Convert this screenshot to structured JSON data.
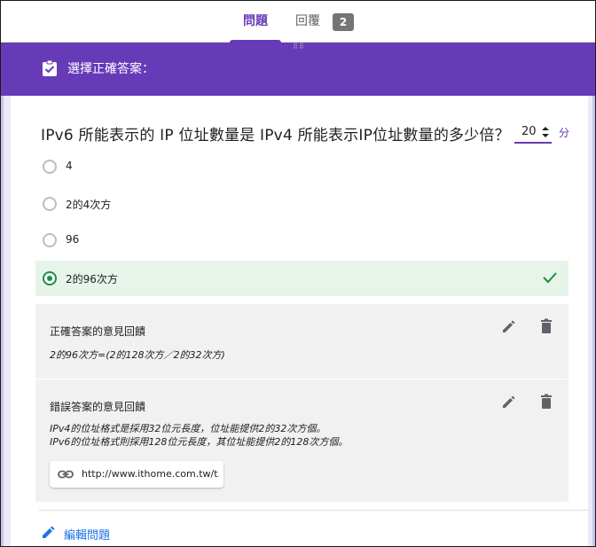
{
  "tabs": [
    {
      "label": "問題"
    },
    {
      "label": "回覆",
      "count": "2"
    }
  ],
  "header": {
    "label": "選擇正確答案："
  },
  "question": {
    "title": "IPv6 所能表示的 IP 位址數量是 IPv4 所能表示IP位址數量的多少倍？",
    "points_value": "20",
    "points_unit": "分"
  },
  "options": [
    {
      "label": "4"
    },
    {
      "label": "2的4次方"
    },
    {
      "label": "96"
    },
    {
      "label": "2的96次方"
    }
  ],
  "feedback_correct": {
    "title": "正確答案的意見回饋",
    "text": "2的96次方=(2的128次方／2的32次方)"
  },
  "feedback_wrong": {
    "title": "錯誤答案的意見回饋",
    "line1": "IPv4的位址格式是採用32位元長度，位址能提供2的32次方個。",
    "line2": "IPv6的位址格式則採用128位元長度，其位址能提供2的128次方個。",
    "link": "http://www.ithome.com.tw/t..."
  },
  "edit_question": {
    "label": "編輯問題"
  },
  "colors": {
    "accent": "#673ab7",
    "correct": "#1e8e3e",
    "correct_bg": "#e6f4ea",
    "link": "#1a73e8"
  }
}
